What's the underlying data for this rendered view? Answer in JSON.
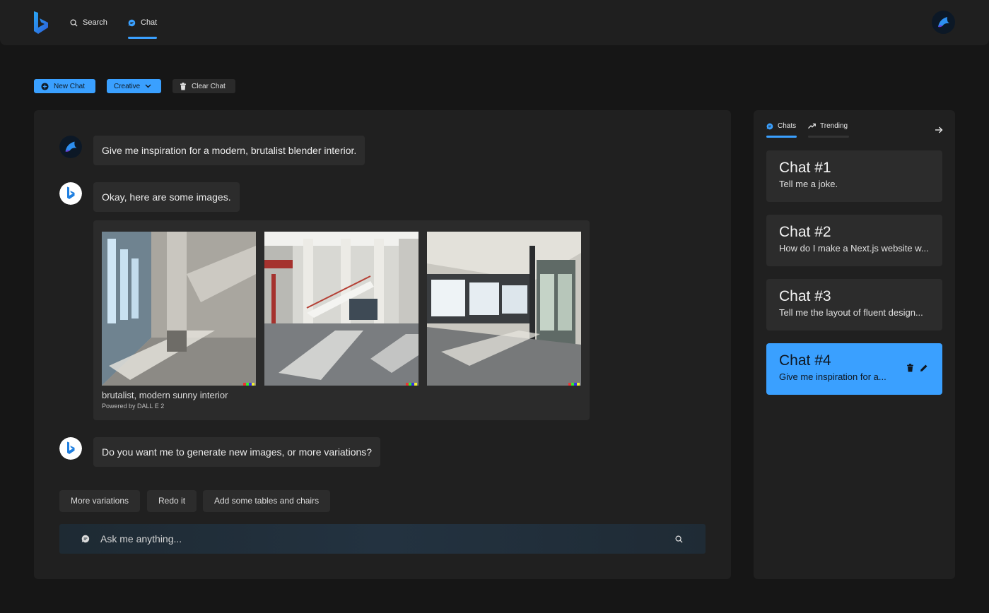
{
  "nav": {
    "search_label": "Search",
    "chat_label": "Chat"
  },
  "toolbar": {
    "new_chat_label": "New Chat",
    "mode_label": "Creative",
    "clear_chat_label": "Clear Chat"
  },
  "conversation": {
    "user_prompt": "Give me inspiration for a modern, brutalist blender interior.",
    "bot_reply_1": "Okay, here are some images.",
    "image_caption": "brutalist, modern sunny interior",
    "image_powered_by": "Powered by DALL E 2",
    "bot_reply_2": "Do you want me to generate new images, or more variations?"
  },
  "suggestions": [
    "More variations",
    "Redo it",
    "Add some tables and chairs"
  ],
  "input": {
    "placeholder": "Ask me anything..."
  },
  "sidebar": {
    "tabs": [
      "Chats",
      "Trending"
    ],
    "chats": [
      {
        "title": "Chat #1",
        "preview": "Tell me a joke."
      },
      {
        "title": "Chat #2",
        "preview": "How do I make a Next.js website w..."
      },
      {
        "title": "Chat #3",
        "preview": "Tell me the layout of fluent design..."
      },
      {
        "title": "Chat #4",
        "preview": "Give me inspiration for a..."
      }
    ]
  },
  "colors": {
    "accent": "#3aa0ff",
    "background": "#161616",
    "panel": "#202020",
    "bubble": "#2c2c2c"
  }
}
